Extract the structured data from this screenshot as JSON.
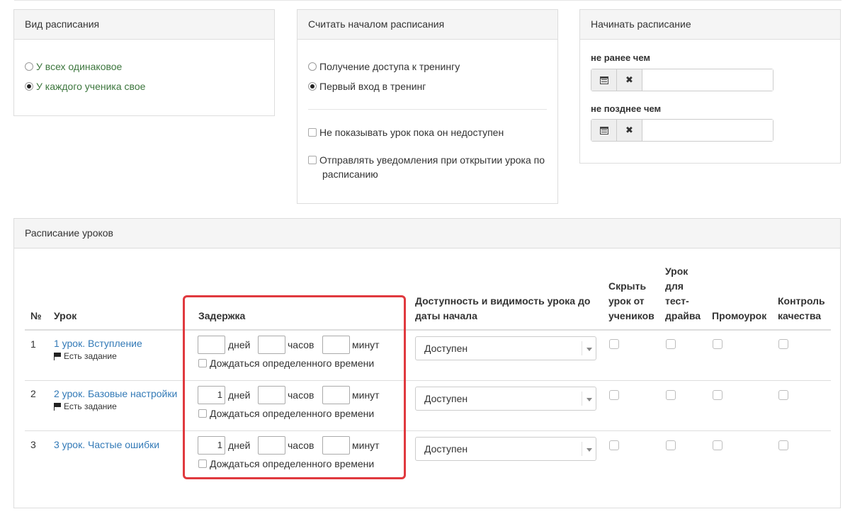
{
  "schedule_type": {
    "title": "Вид расписания",
    "options": [
      "У всех одинаковое",
      "У каждого ученика свое"
    ],
    "selected": 1
  },
  "schedule_start": {
    "title": "Считать началом расписания",
    "options": [
      "Получение доступа к тренингу",
      "Первый вход в тренинг"
    ],
    "selected": 1,
    "checkboxes": [
      "Не показывать урок пока он недоступен",
      "Отправлять уведомления при открытии урока по",
      "расписанию"
    ]
  },
  "start_schedule": {
    "title": "Начинать расписание",
    "not_before_label": "не ранее чем",
    "not_after_label": "не позднее чем",
    "not_before_value": "",
    "not_after_value": ""
  },
  "lessons": {
    "title": "Расписание уроков",
    "headers": {
      "num": "№",
      "lesson": "Урок",
      "delay": "Задержка",
      "availability_1": "Доступность и видимость урока до",
      "availability_2": "даты начала",
      "hide_1": "Скрыть",
      "hide_2": "урок от",
      "hide_3": "учеников",
      "test_1": "Урок",
      "test_2": "для",
      "test_3": "тест-",
      "test_4": "драйва",
      "promo": "Промоурок",
      "quality_1": "Контроль",
      "quality_2": "качества"
    },
    "units": {
      "days": "дней",
      "hours": "часов",
      "minutes": "минут"
    },
    "wait_label": "Дождаться определенного времени",
    "rows": [
      {
        "num": "1",
        "name": "1 урок. Вступление",
        "task": "Есть задание",
        "days": "",
        "hours": "",
        "minutes": "",
        "availability": "Доступен"
      },
      {
        "num": "2",
        "name": "2 урок. Базовые настройки",
        "task": "Есть задание",
        "days": "1",
        "hours": "",
        "minutes": "",
        "availability": "Доступен"
      },
      {
        "num": "3",
        "name": "3 урок. Частые ошибки",
        "task": "",
        "days": "1",
        "hours": "",
        "minutes": "",
        "availability": "Доступен"
      }
    ]
  },
  "colors": {
    "highlight": "#e0393e",
    "link": "#337ab7",
    "radio_label": "#3c763d"
  }
}
